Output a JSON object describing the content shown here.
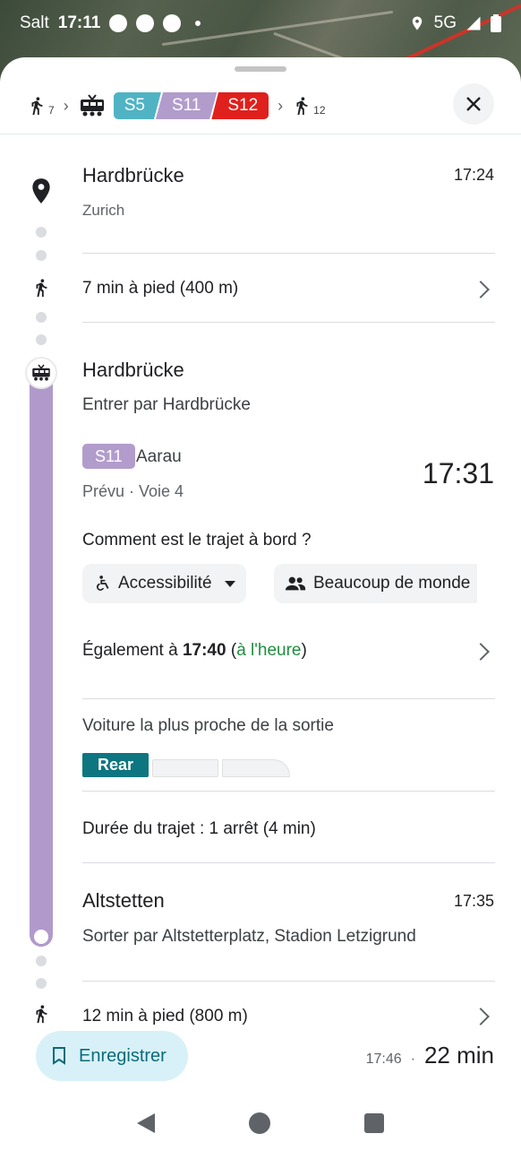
{
  "status_bar": {
    "carrier": "Salt",
    "time": "17:11",
    "network": "5G"
  },
  "route_summary": {
    "walk_start_minutes": "7",
    "lines": [
      "S5",
      "S11",
      "S12"
    ],
    "walk_end_minutes": "12"
  },
  "origin": {
    "name": "Hardbrücke",
    "city": "Zurich",
    "time": "17:24"
  },
  "walk_1": {
    "label": "7 min à pied (400 m)"
  },
  "boarding": {
    "station": "Hardbrücke",
    "entrance": "Entrer par Hardbrücke",
    "line": "S11",
    "destination": "Aarau",
    "status": "Prévu · Voie 4",
    "departure": "17:31"
  },
  "onboard": {
    "question": "Comment est le trajet à bord ?",
    "chip_accessibility": "Accessibilité",
    "chip_crowded": "Beaucoup de monde"
  },
  "also_at": {
    "prefix": "Également à ",
    "time": "17:40",
    "status_open": " (",
    "status": "à l'heure",
    "status_close": ")"
  },
  "exit_car": {
    "label": "Voiture la plus proche de la sortie",
    "active": "Rear"
  },
  "ride_duration": {
    "label": "Durée du trajet : 1 arrêt (4 min)"
  },
  "arrival_stop": {
    "name": "Altstetten",
    "time": "17:35",
    "exit": "Sorter par Altstetterplatz, Stadion Letzigrund"
  },
  "walk_2": {
    "label": "12 min à pied (800 m)"
  },
  "footer": {
    "save_label": "Enregistrer",
    "arrival_time": "17:46",
    "separator": "·",
    "duration": "22 min"
  },
  "colors": {
    "s5": "#50b3c4",
    "s11": "#b29ccc",
    "s12": "#e0201c",
    "on_time": "#1e8e3e",
    "rear_car": "#0d7680"
  }
}
